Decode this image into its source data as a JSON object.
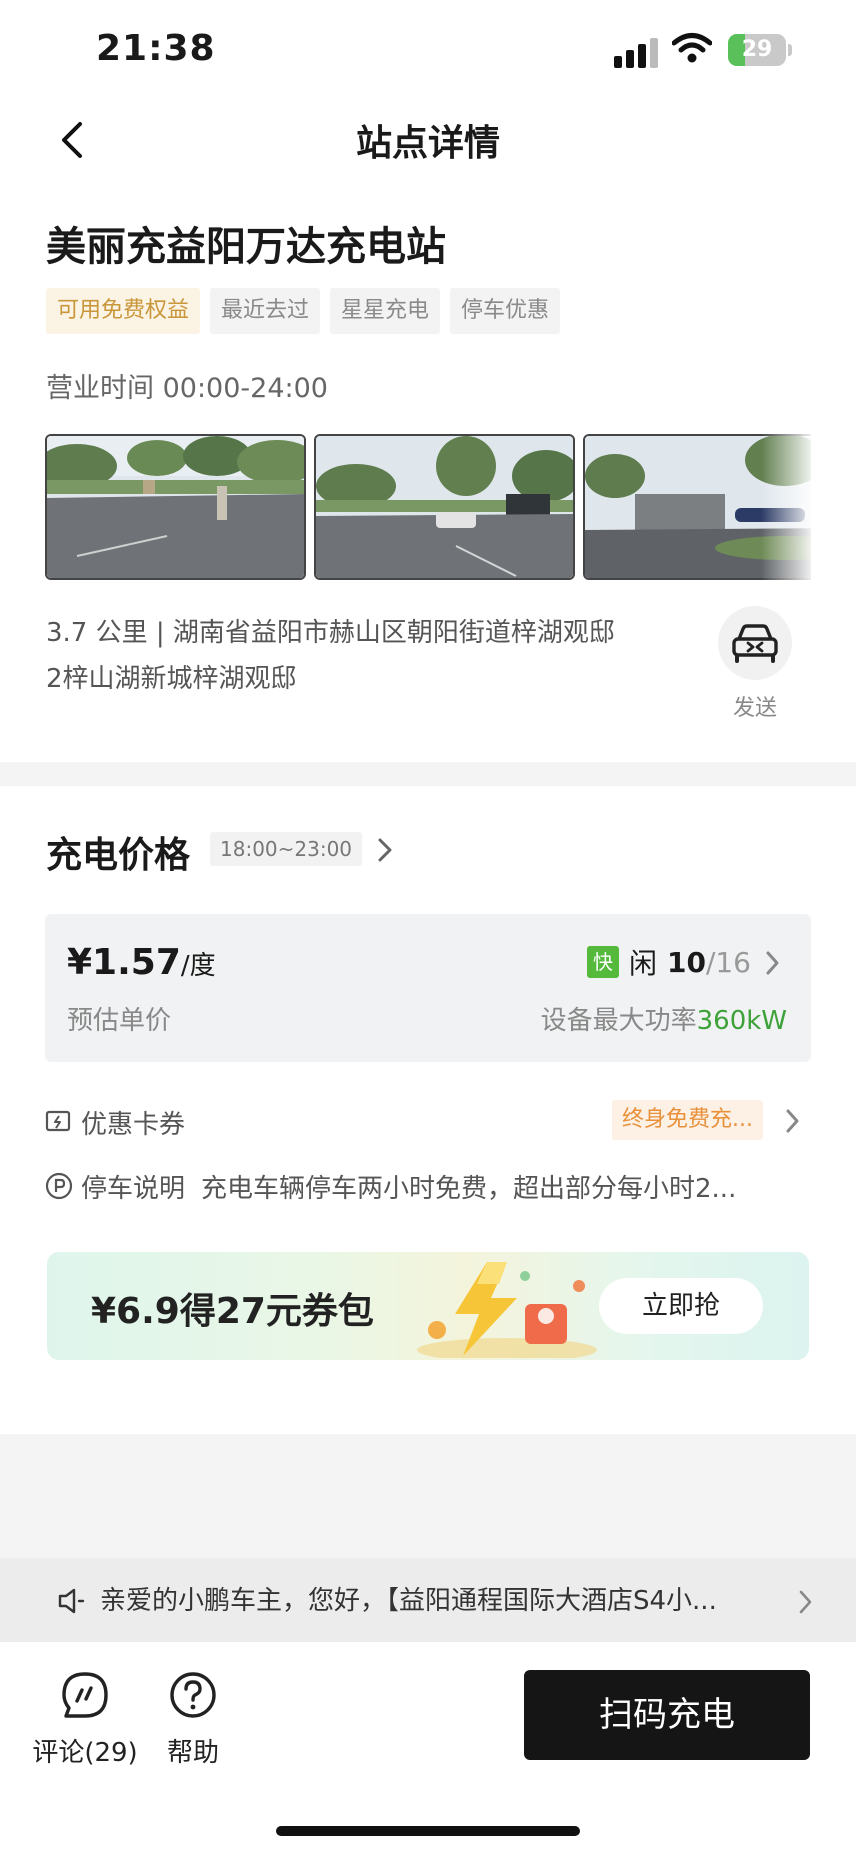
{
  "status_bar": {
    "time": "21:38",
    "battery_percent": "29",
    "battery_level": 0.29
  },
  "nav": {
    "title": "站点详情"
  },
  "station": {
    "name": "美丽充益阳万达充电站",
    "tags": [
      "可用免费权益",
      "最近去过",
      "星星充电",
      "停车优惠"
    ],
    "hours": "营业时间 00:00-24:00",
    "address_line1": "3.7 公里 | 湖南省益阳市赫山区朝阳街道梓湖观邸",
    "address_line2": "2梓山湖新城梓湖观邸",
    "send_label": "发送"
  },
  "pricing": {
    "heading": "充电价格",
    "period": "18:00~23:00",
    "price": "¥1.57",
    "unit": "/度",
    "price_caption": "预估单价",
    "fast_badge": "快",
    "idle_label": "闲",
    "idle_count": "10",
    "total_count": "/16",
    "power_label": "设备最大功率",
    "power_value": "360kW"
  },
  "coupons": {
    "label": "优惠卡券",
    "badge": "终身免费充..."
  },
  "parking": {
    "label": "停车说明",
    "desc": "充电车辆停车两小时免费，超出部分每小时2..."
  },
  "promo": {
    "text": "¥6.9得27元券包",
    "button": "立即抢"
  },
  "notice": {
    "text": "亲爱的小鹏车主，您好，【益阳通程国际大酒店S4小..."
  },
  "bottom": {
    "comments_label": "评论(29)",
    "help_label": "帮助",
    "scan_button": "扫码充电"
  },
  "colors": {
    "accent_green": "#3ea23a",
    "fast_badge": "#55ba3c",
    "coupon_orange": "#e8903a",
    "tag_gold": "#c9963a",
    "scan_button_bg": "#151515"
  }
}
